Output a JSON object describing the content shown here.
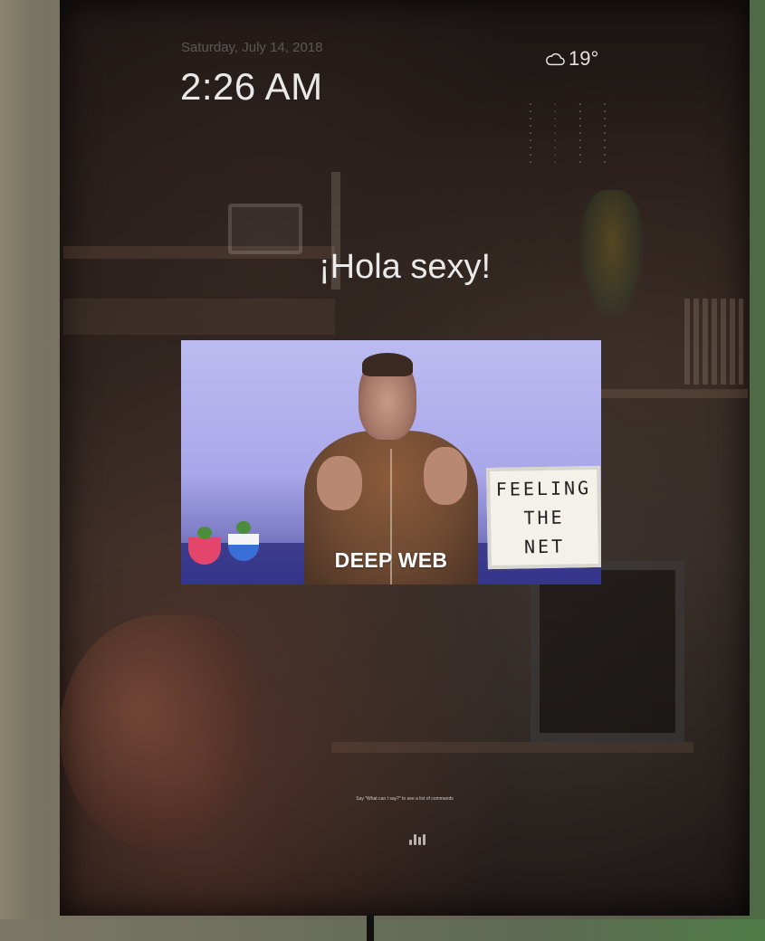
{
  "clock": {
    "date": "Saturday, July 14, 2018",
    "time": "2:26 AM"
  },
  "weather": {
    "icon": "cloud-icon",
    "temperature": "19°"
  },
  "greeting": "¡Hola sexy!",
  "video": {
    "caption": "DEEP WEB",
    "lightbox_lines": [
      "FEELING",
      "THE",
      "NET"
    ]
  },
  "voice": {
    "hint": "Say \"What can I say?\" to see a list of commands",
    "icon": "microphone-icon"
  }
}
